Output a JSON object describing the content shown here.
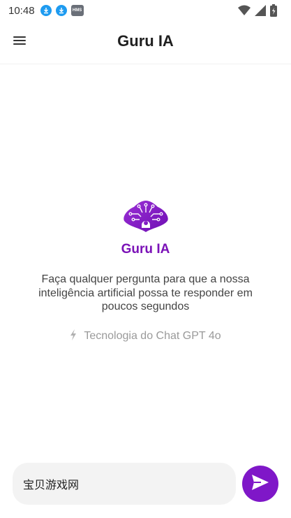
{
  "status_bar": {
    "time": "10:48",
    "notification_icons": [
      "download-icon",
      "download-icon",
      "hms-icon"
    ],
    "hms_text": "HMS",
    "system_icons": [
      "wifi-icon",
      "signal-icon",
      "battery-icon"
    ]
  },
  "app_bar": {
    "title": "Guru IA",
    "menu_icon": "hamburger-menu-icon"
  },
  "hero": {
    "logo_icon": "brain-circuit-logo-icon",
    "brand": "Guru IA",
    "description": "Faça qualquer pergunta para que a nossa inteligência artificial possa te responder em poucos segundos",
    "tech_icon": "lightning-bolt-icon",
    "tech_label": "Tecnologia do Chat GPT 4o"
  },
  "composer": {
    "input_value": "宝贝游戏网",
    "send_icon": "send-icon"
  },
  "colors": {
    "accent": "#7f17c8",
    "brand_text": "#7b12b7",
    "muted_text": "#9a9a9a",
    "input_bg": "#f3f3f3"
  }
}
